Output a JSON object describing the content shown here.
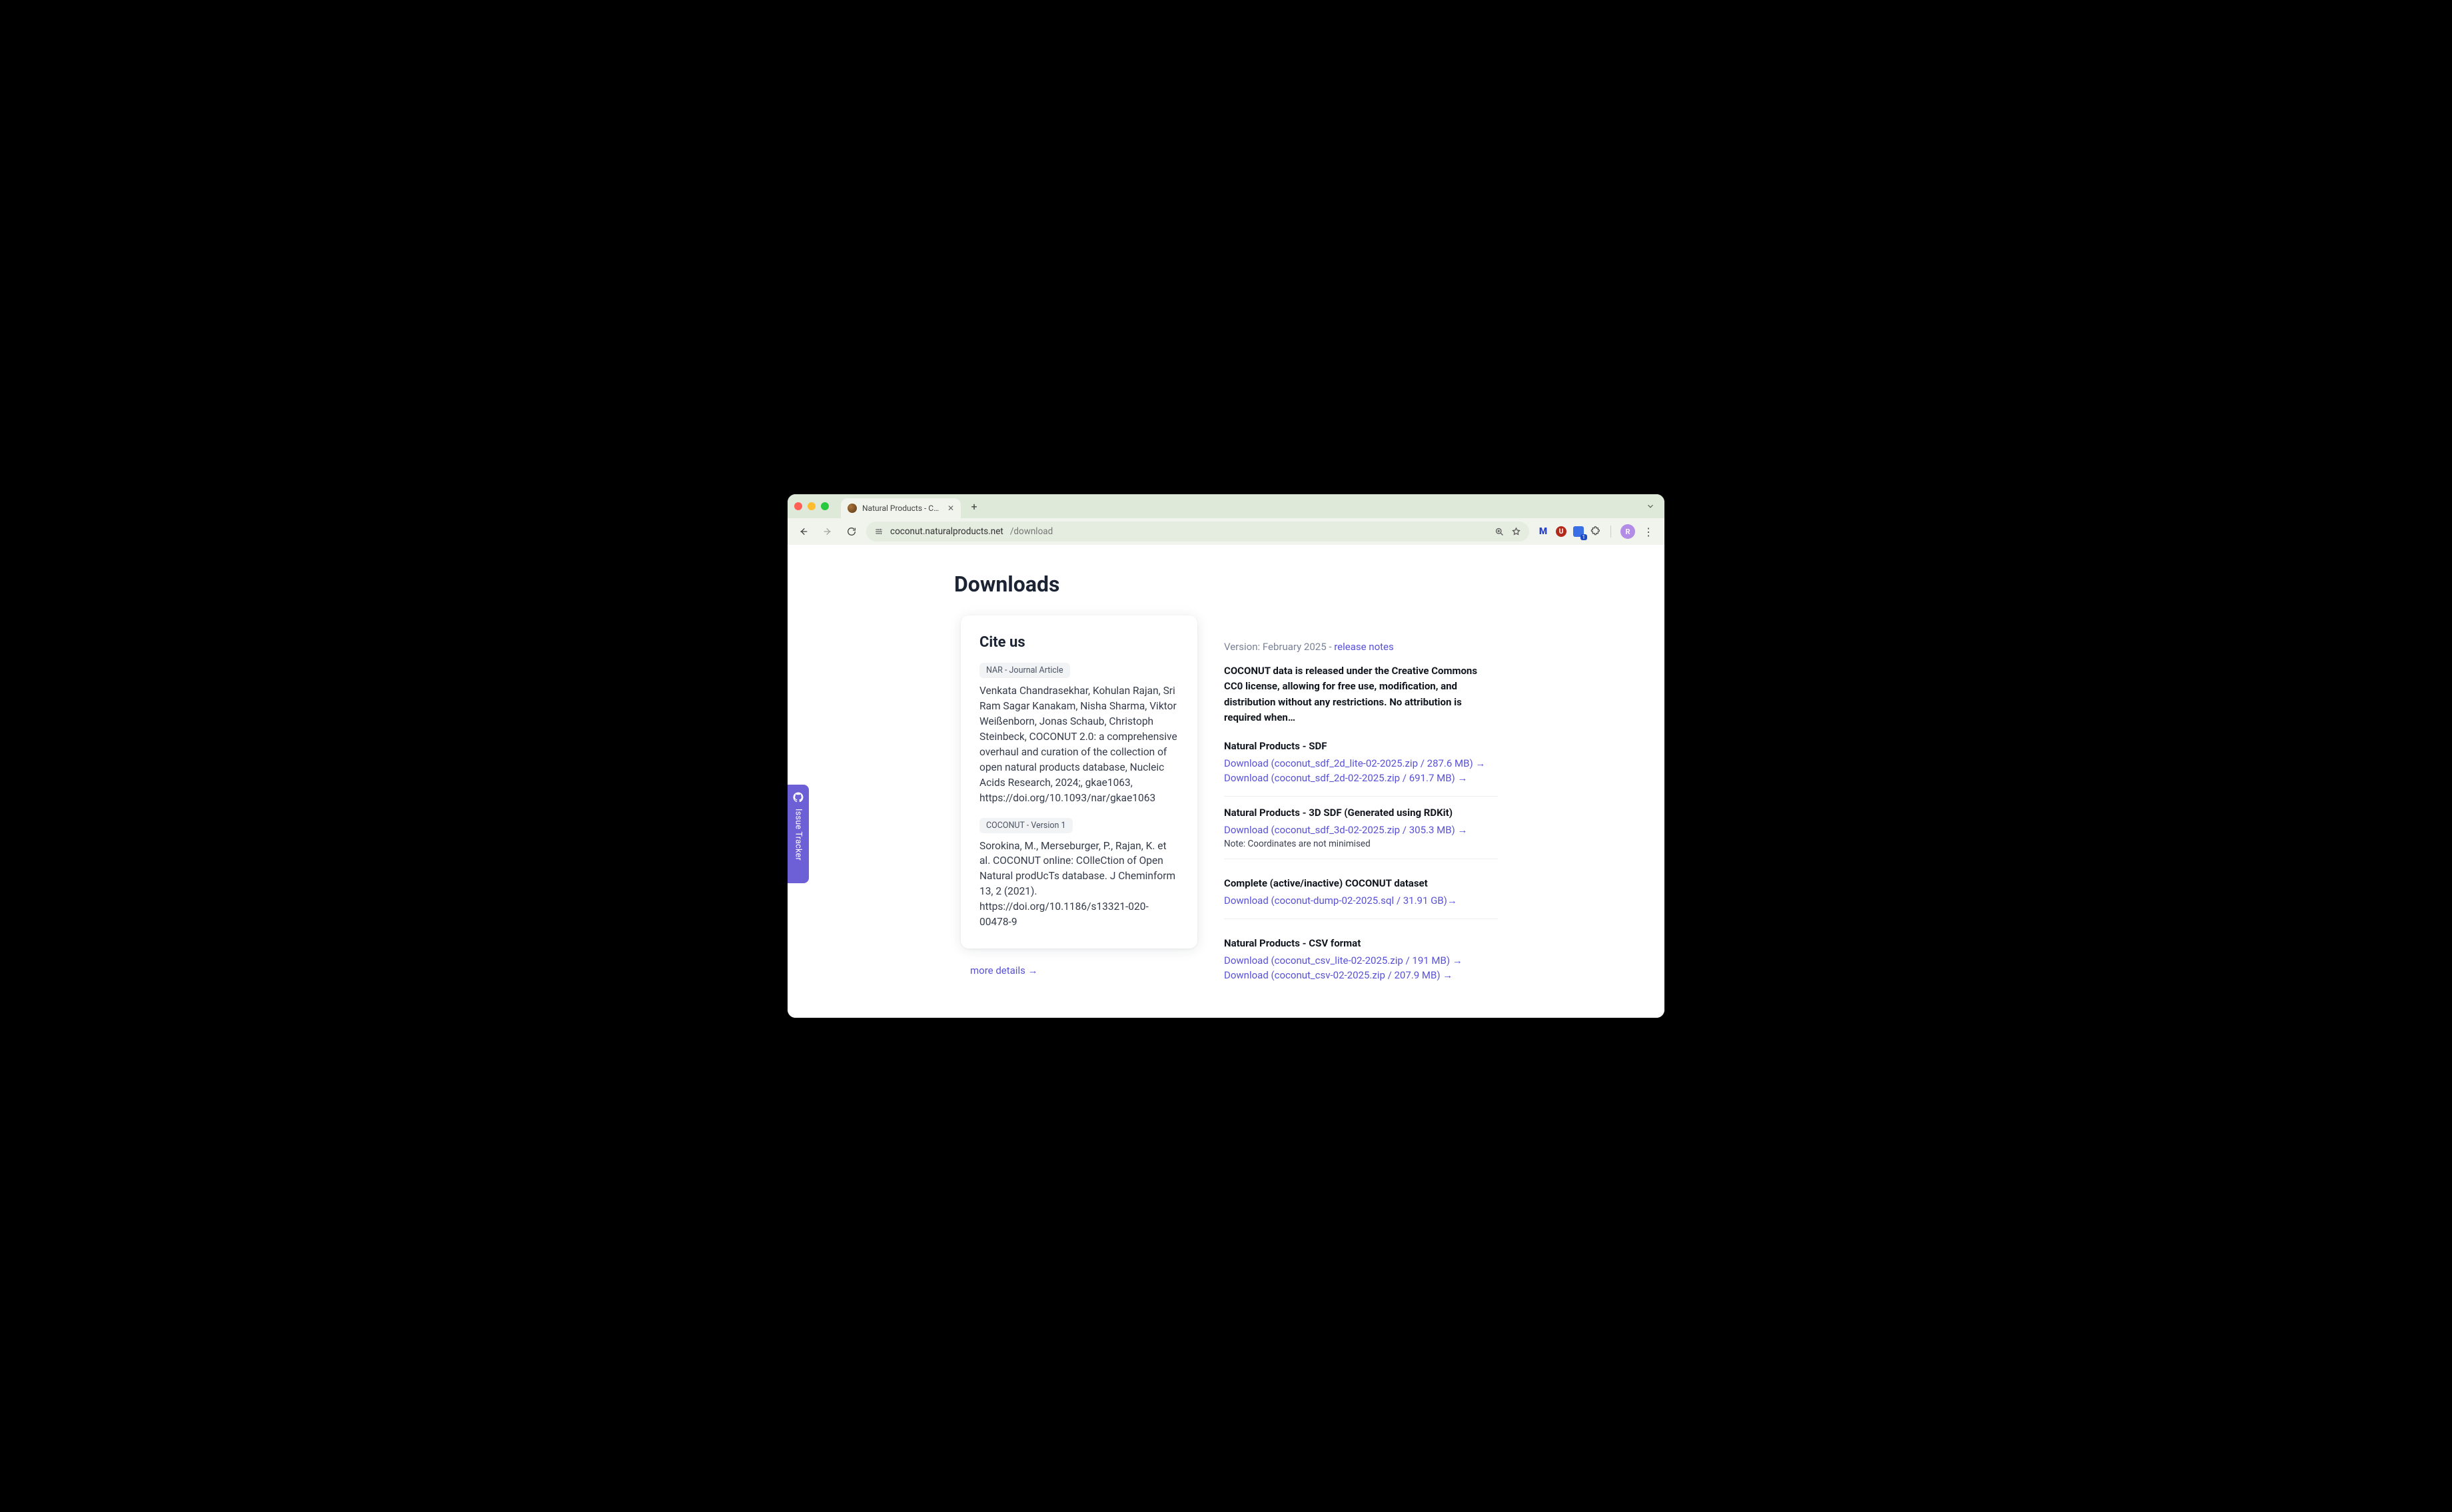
{
  "browser": {
    "tab_title": "Natural Products - COCONUT",
    "url_host": "coconut.naturalproducts.net",
    "url_path": "/download",
    "avatar_initial": "R"
  },
  "page_title": "Downloads",
  "cite": {
    "heading": "Cite us",
    "entries": [
      {
        "badge": "NAR - Journal Article",
        "text": "Venkata Chandrasekhar, Kohulan Rajan, Sri Ram Sagar Kanakam, Nisha Sharma, Viktor Weißenborn, Jonas Schaub, Christoph Steinbeck, COCONUT 2.0: a comprehensive overhaul and curation of the collection of open natural products database, Nucleic Acids Research, 2024;, gkae1063, https://doi.org/10.1093/nar/gkae1063"
      },
      {
        "badge": "COCONUT - Version 1",
        "text": "Sorokina, M., Merseburger, P., Rajan, K. et al. COCONUT online: COlleCtion of Open Natural prodUcTs database. J Cheminform 13, 2 (2021). https://doi.org/10.1186/s13321-020-00478-9"
      }
    ],
    "more": "more details →"
  },
  "version_prefix": "Version: February 2025 - ",
  "release_notes": "release notes",
  "license_text": "COCONUT data is released under the Creative Commons CC0 license, allowing for free use, modification, and distribution without any restrictions. No attribution is required when…",
  "sections": [
    {
      "heading": "Natural Products - SDF",
      "links": [
        "Download (coconut_sdf_2d_lite-02-2025.zip / 287.6 MB) →",
        "Download (coconut_sdf_2d-02-2025.zip / 691.7 MB) →"
      ],
      "note": ""
    },
    {
      "heading": "Natural Products - 3D SDF (Generated using RDKit)",
      "links": [
        "Download (coconut_sdf_3d-02-2025.zip / 305.3 MB) →"
      ],
      "note": "Note: Coordinates are not minimised"
    },
    {
      "heading": "Complete (active/inactive) COCONUT dataset",
      "links": [
        "Download (coconut-dump-02-2025.sql / 31.91 GB)→"
      ],
      "note": ""
    },
    {
      "heading": "Natural Products - CSV format",
      "links": [
        "Download (coconut_csv_lite-02-2025.zip / 191 MB) →",
        "Download (coconut_csv-02-2025.zip / 207.9 MB) →"
      ],
      "note": ""
    }
  ],
  "issue_tracker": "Issue Tracker"
}
